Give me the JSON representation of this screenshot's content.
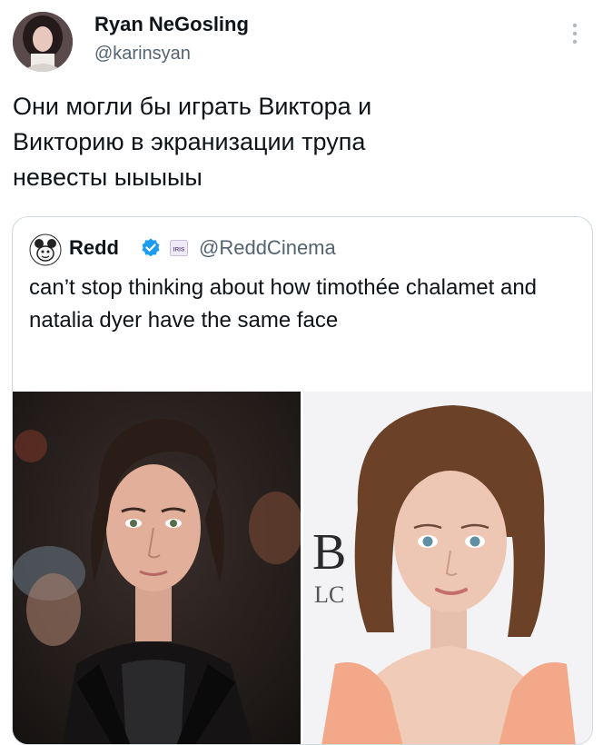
{
  "tweet": {
    "display_name": "Ryan NeGosling",
    "handle": "@karinsyan",
    "text": "Они могли бы играть Виктора и\nВикторию в экранизации трупа\nневесты ыыыыы",
    "more_icon": "more-vertical-icon"
  },
  "quote": {
    "display_name": "Redd",
    "handle": "@ReddCinema",
    "text": "can’t stop thinking about how timothée chalamet and natalia dyer have the same face",
    "verified_icon": "verified-badge-icon",
    "affiliate_icon": "affiliate-badge-icon",
    "affiliate_badge_text": "IRIS",
    "photo_sign_letter_top": "B",
    "photo_sign_letter_bottom": "LC"
  },
  "colors": {
    "text_primary": "#0f1419",
    "text_secondary": "#536471",
    "border": "#cfd9de",
    "verified_blue": "#1d9bf0"
  }
}
